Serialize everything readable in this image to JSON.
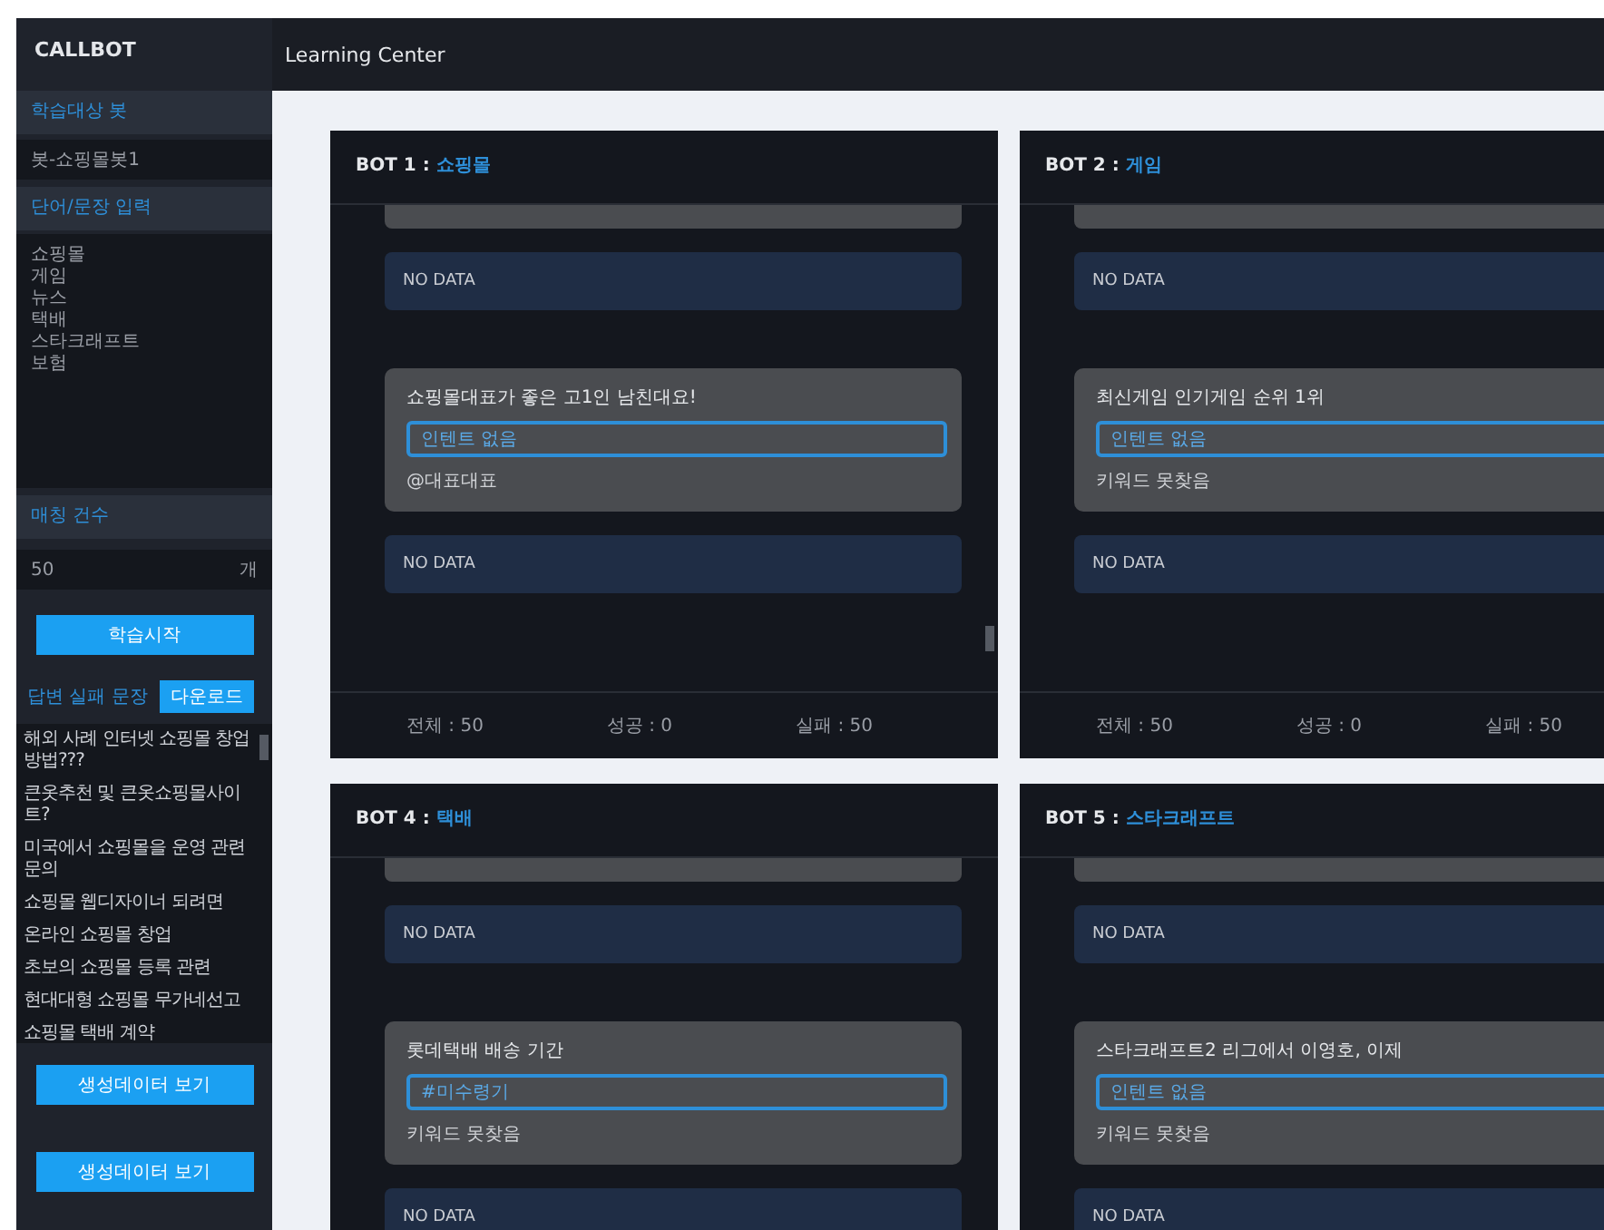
{
  "sidebar": {
    "logo": "CALLBOT",
    "sections": [
      {
        "kind": "field",
        "title": "학습대상 봇",
        "value": "봇-쇼핑몰봇1"
      },
      {
        "kind": "textarea",
        "title": "단어/문장 입력",
        "lines": [
          "쇼핑몰",
          "게임",
          "뉴스",
          "택배",
          "스타크래프트",
          "보험"
        ]
      },
      {
        "kind": "count",
        "title": "매칭 건수",
        "value": "50",
        "unit": "개"
      }
    ],
    "start_button": "학습시작",
    "failed": {
      "title": "답변 실패 문장",
      "download_button": "다운로드",
      "items": [
        "해외 사례 인터넷 쇼핑몰 창업방법???",
        "큰옷추천 및 큰옷쇼핑몰사이트?",
        "미국에서 쇼핑몰을 운영 관련 문의",
        "쇼핑몰 웹디자이너 되려면",
        "온라인 쇼핑몰 창업",
        "초보의 쇼핑몰 등록 관련",
        "현대대형 쇼핑몰 무가네선고",
        "쇼핑몰 택배 계약"
      ]
    },
    "view_buttons": [
      "생성데이터 보기",
      "생성데이터 보기"
    ]
  },
  "header": {
    "title": "Learning Center"
  },
  "bots": [
    {
      "label": "BOT 1 : ",
      "topic": "쇼핑몰",
      "scrollbar": true,
      "messages": [
        {
          "kind": "partial"
        },
        {
          "kind": "nodata",
          "text": "NO DATA"
        },
        {
          "kind": "question",
          "text": "쇼핑몰대표가 좋은 고1인 남친대요!",
          "field": {
            "placeholder": "인텐트 없음"
          },
          "reply": "@대표대표"
        },
        {
          "kind": "nodata",
          "text": "NO DATA"
        }
      ],
      "stats": [
        "전체 : 50",
        "성공 : 0",
        "실패 : 50"
      ]
    },
    {
      "label": "BOT 2 : ",
      "topic": "게임",
      "scrollbar": false,
      "messages": [
        {
          "kind": "partial"
        },
        {
          "kind": "nodata",
          "text": "NO DATA"
        },
        {
          "kind": "question",
          "text": "최신게임 인기게임 순위 1위",
          "field": {
            "placeholder": "인텐트 없음"
          },
          "reply": "키워드 못찾음"
        },
        {
          "kind": "nodata",
          "text": "NO DATA"
        }
      ],
      "stats": [
        "전체 : 50",
        "성공 : 0",
        "실패 : 50"
      ]
    },
    {
      "label": "BOT 4 : ",
      "topic": "택배",
      "scrollbar": false,
      "messages": [
        {
          "kind": "partial"
        },
        {
          "kind": "nodata",
          "text": "NO DATA"
        },
        {
          "kind": "question",
          "text": "롯데택배 배송 기간",
          "field": {
            "value": "#미수령기"
          },
          "reply": "키워드 못찾음"
        },
        {
          "kind": "nodata",
          "text": "NO DATA"
        }
      ]
    },
    {
      "label": "BOT 5 : ",
      "topic": "스타크래프트",
      "scrollbar": false,
      "messages": [
        {
          "kind": "partial"
        },
        {
          "kind": "nodata",
          "text": "NO DATA"
        },
        {
          "kind": "question",
          "text": "스타크래프트2 리그에서 이영호, 이제",
          "field": {
            "placeholder": "인텐트 없음"
          },
          "reply": "키워드 못찾음"
        },
        {
          "kind": "nodata",
          "text": "NO DATA"
        }
      ]
    }
  ]
}
